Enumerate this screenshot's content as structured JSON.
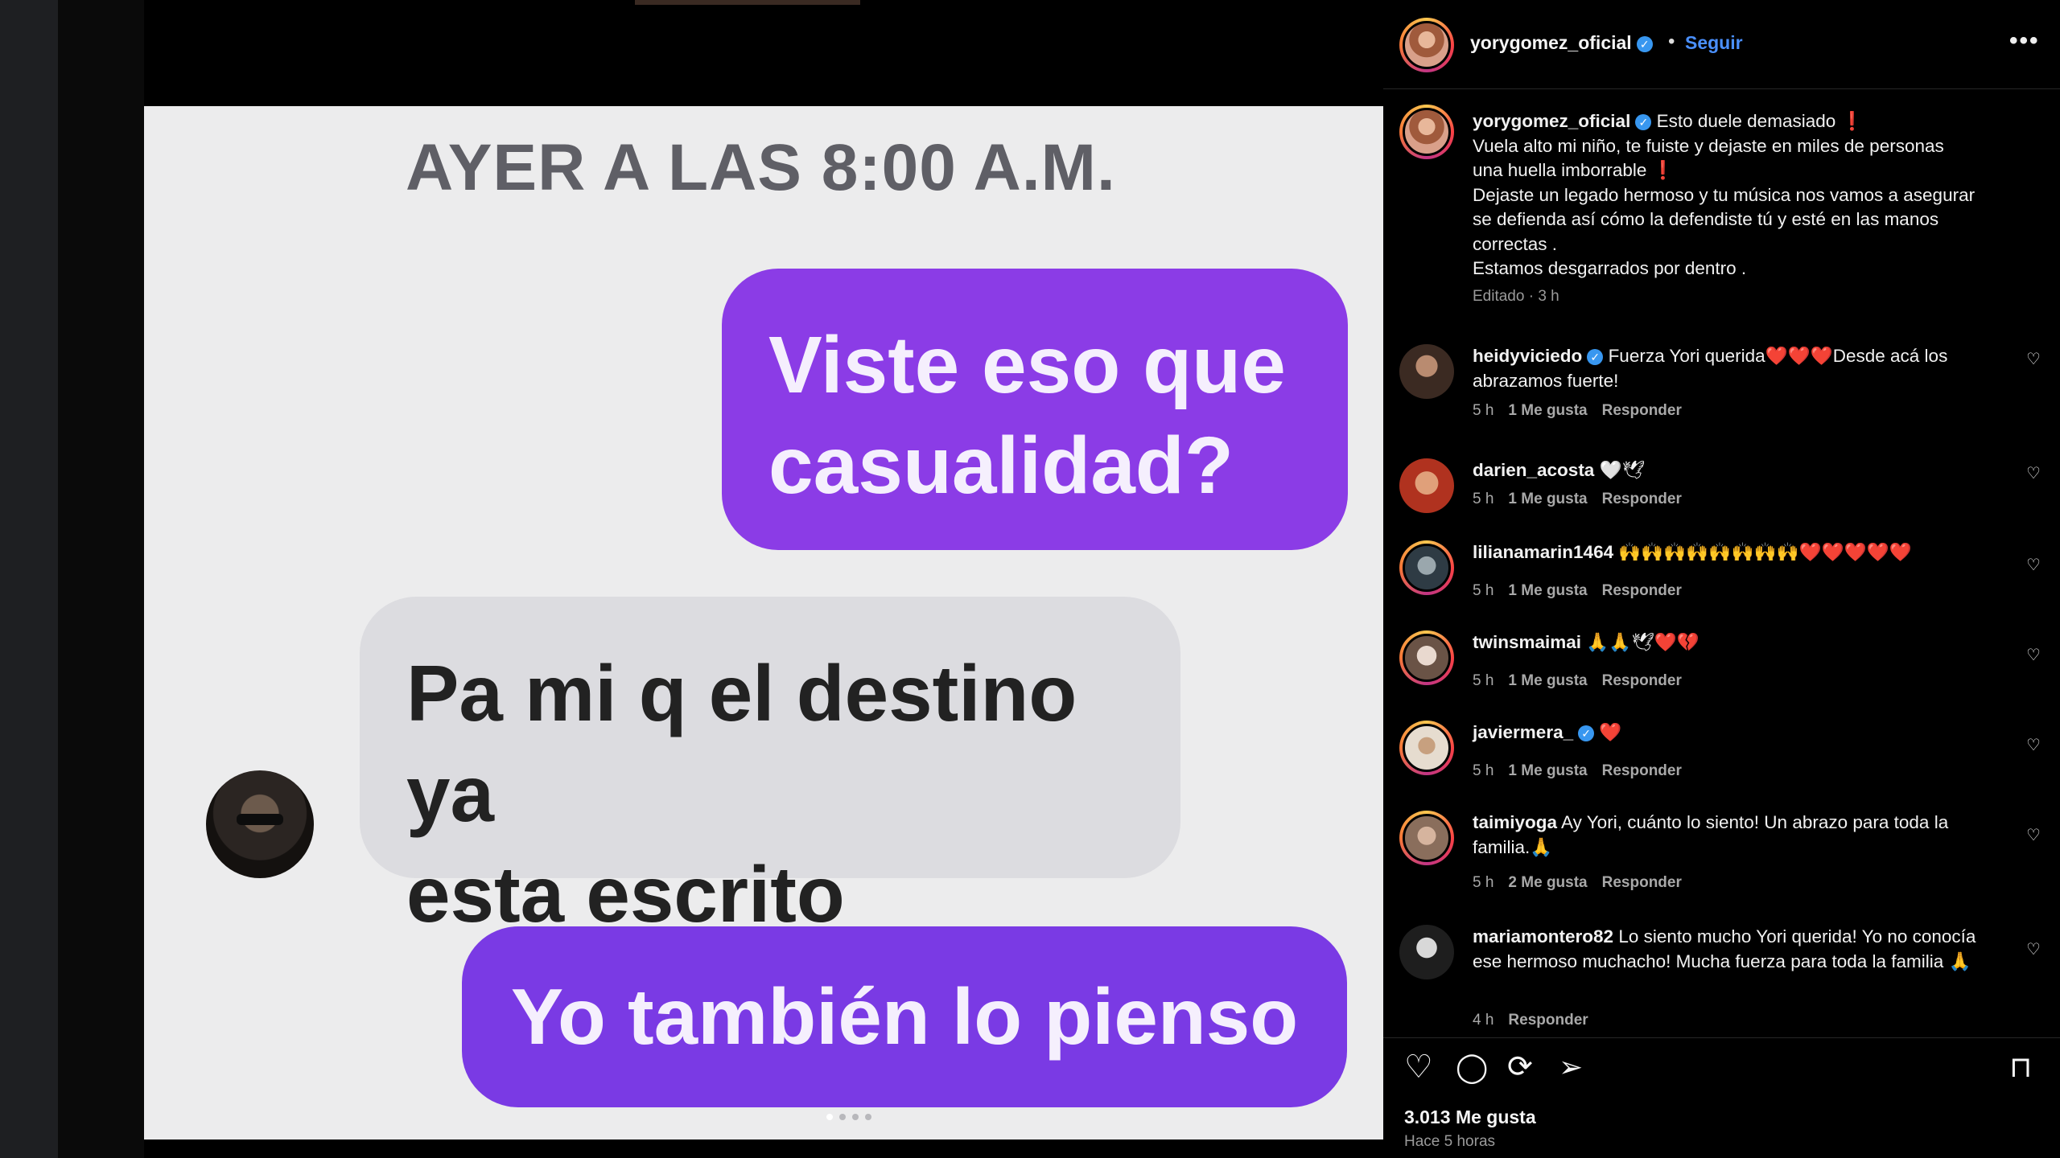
{
  "post": {
    "chat_image": {
      "timestamp": "AYER A LAS 8:00 A.M.",
      "bubble_1": [
        "Viste eso que",
        "casualidad?"
      ],
      "bubble_2": [
        "Pa mi q el destino ya",
        "esta escrito"
      ],
      "bubble_3": "Yo también lo pienso",
      "next_glyph": "›"
    }
  },
  "header": {
    "username": "yorygomez_oficial",
    "dot": "•",
    "follow_label": "Seguir",
    "more_glyph": "•••"
  },
  "caption": {
    "username": "yorygomez_oficial",
    "lines": [
      "Esto duele demasiado",
      "Vuela alto mi niño, te fuiste y dejaste en miles de personas",
      "una huella imborrable",
      "Dejaste un legado hermoso y tu música nos vamos a asegurar",
      "se defienda así cómo la defendiste tú y esté en las manos",
      "correctas .",
      "Estamos desgarrados por dentro ."
    ],
    "exclamation": "❗",
    "edited": "Editado · 3 h"
  },
  "comments": [
    {
      "user": "heidyviciedo",
      "verified": true,
      "text": "Fuerza Yori querida❤️❤️❤️Desde acá los abrazamos fuerte!",
      "time": "5 h",
      "likes": "1 Me gusta",
      "reply": "Responder"
    },
    {
      "user": "darien_acosta",
      "verified": false,
      "text": "🤍🕊",
      "time": "5 h",
      "likes": "1 Me gusta",
      "reply": "Responder"
    },
    {
      "user": "lilianamarin1464",
      "verified": false,
      "text": "🙌🙌🙌🙌🙌🙌🙌🙌❤️❤️❤️❤️❤️",
      "time": "5 h",
      "likes": "1 Me gusta",
      "reply": "Responder"
    },
    {
      "user": "twinsmaimai",
      "verified": false,
      "text": "🙏🙏🕊❤️💔",
      "time": "5 h",
      "likes": "1 Me gusta",
      "reply": "Responder"
    },
    {
      "user": "javiermera_",
      "verified": true,
      "text": "❤️",
      "time": "5 h",
      "likes": "1 Me gusta",
      "reply": "Responder"
    },
    {
      "user": "taimiyoga",
      "verified": false,
      "text": "Ay Yori, cuánto lo siento! Un abrazo para toda la familia.🙏",
      "time": "5 h",
      "likes": "2 Me gusta",
      "reply": "Responder"
    },
    {
      "user": "mariamontero82",
      "verified": false,
      "text": "Lo siento mucho Yori querida! Yo no conocía ese hermoso muchacho! Mucha fuerza para toda la familia 🙏",
      "time": "4 h",
      "likes": "",
      "reply": "Responder"
    }
  ],
  "actions": {
    "like_glyph": "♡",
    "comment_glyph": "◯",
    "share_glyph": "⟳",
    "send_glyph": "➢",
    "save_glyph": "⊓"
  },
  "stats": {
    "likes": "3.013 Me gusta",
    "posted": "Hace 5 horas"
  },
  "icons": [
    "heart-icon",
    "comment-icon",
    "repost-icon",
    "send-icon",
    "bookmark-icon",
    "verified-icon",
    "more-icon",
    "chevron-right-icon"
  ],
  "colors": {
    "accent": "#4a90ff",
    "bubble_purple": "#8b3ce6",
    "bubble_gray": "#dcdce0"
  }
}
